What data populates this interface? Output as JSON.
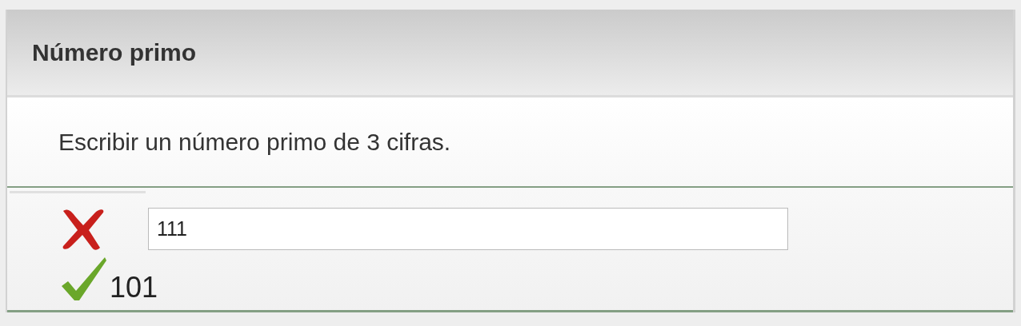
{
  "title": "Número primo",
  "question": "Escribir un número primo de 3 cifras.",
  "answer": {
    "value": "111",
    "correct": false
  },
  "solution": "101"
}
